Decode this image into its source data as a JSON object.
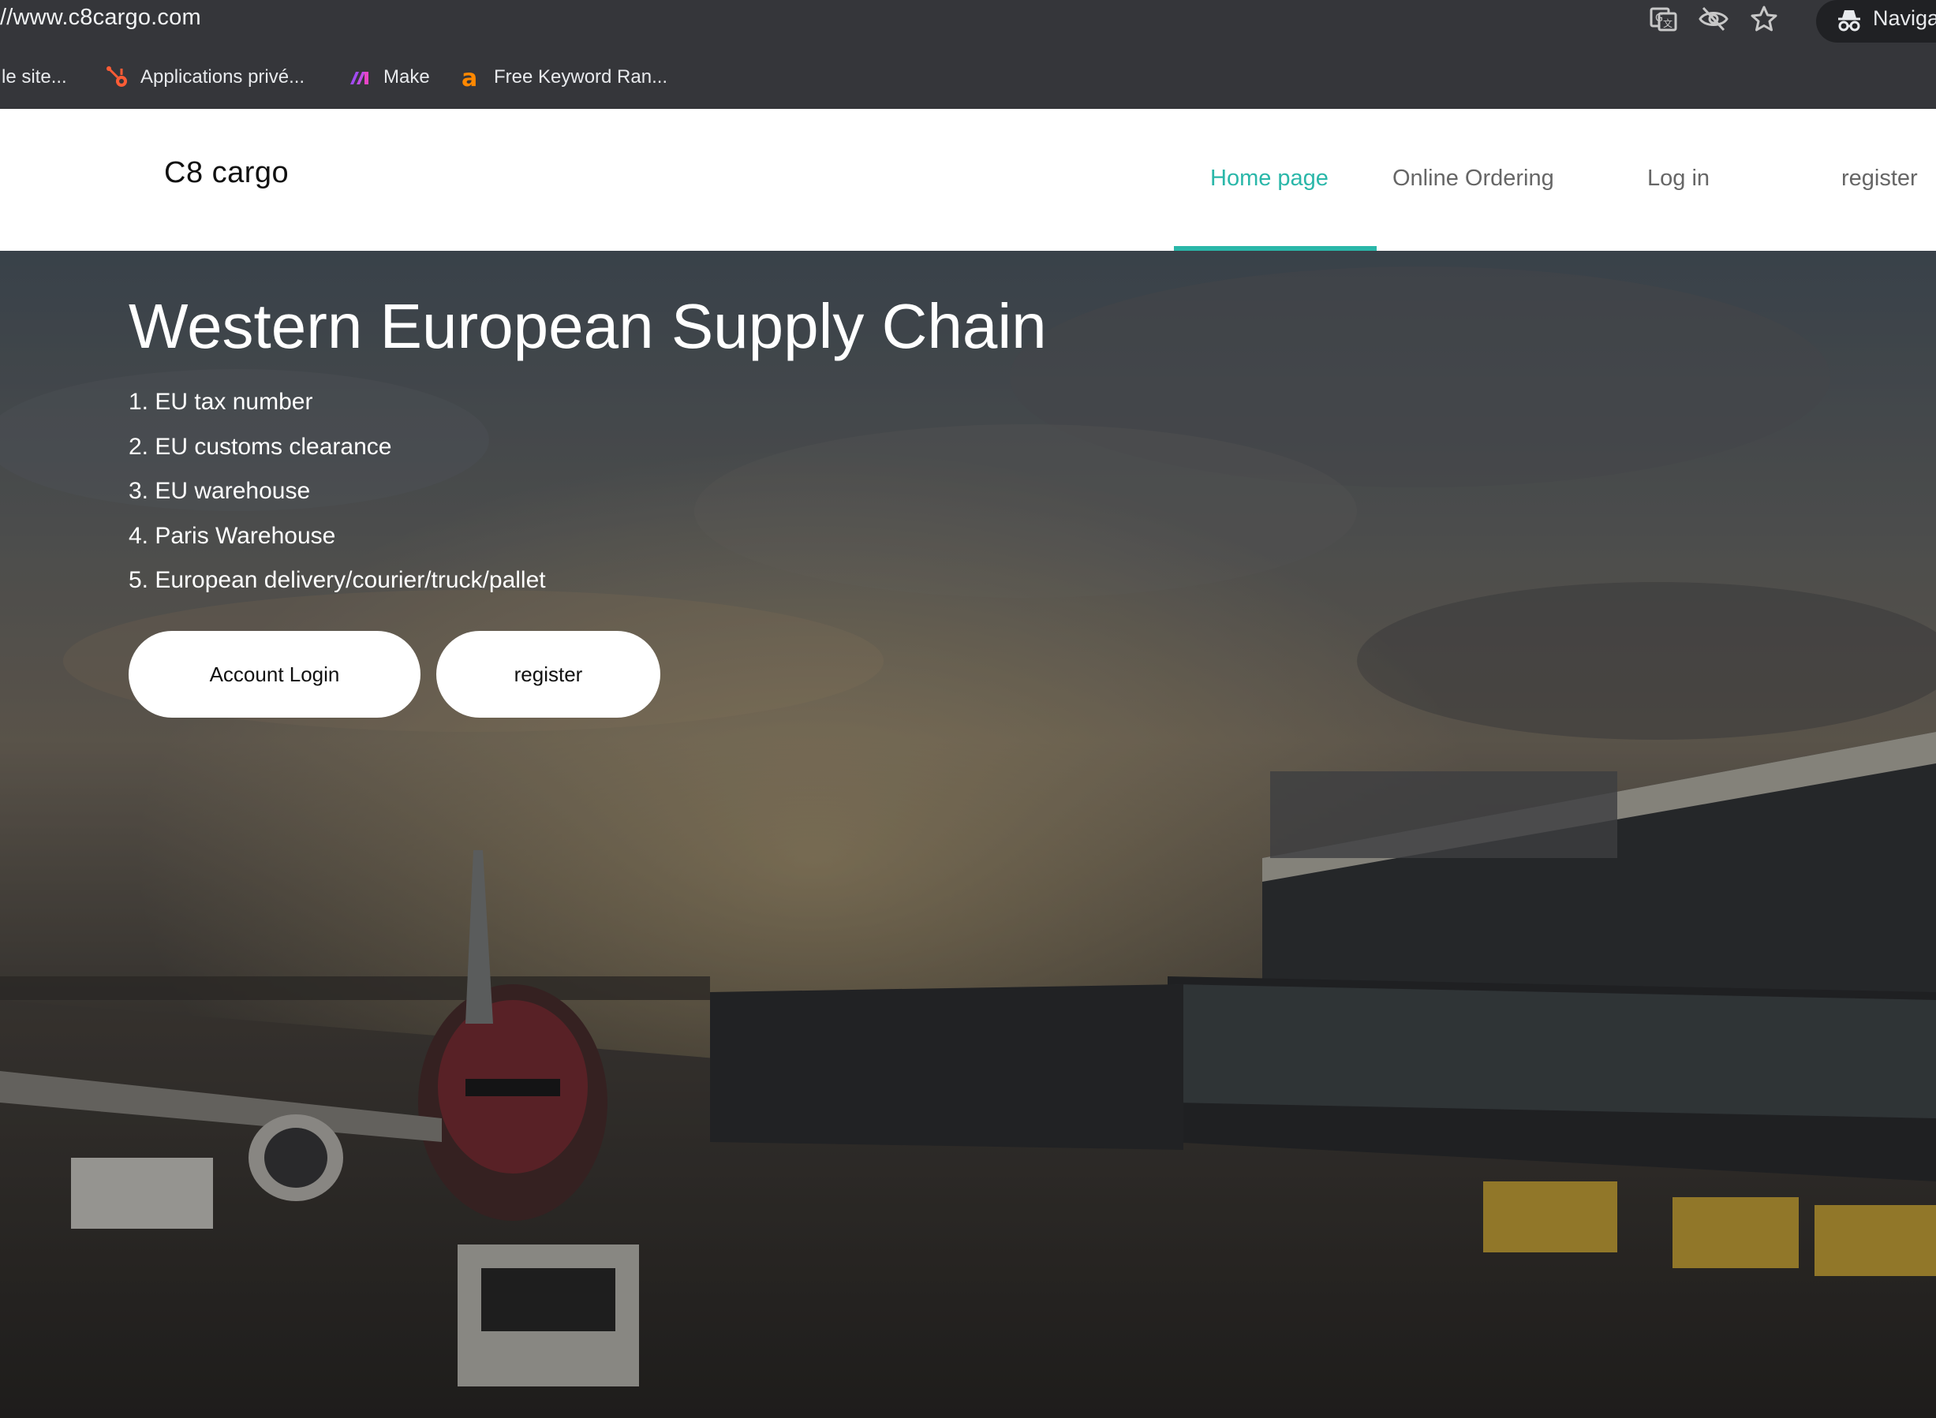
{
  "browser": {
    "url": "//www.c8cargo.com",
    "profile_label": "Naviga",
    "icons": [
      "translate-icon",
      "eye-slash-icon",
      "star-icon",
      "incognito-icon"
    ],
    "bookmarks": [
      {
        "label": "le site...",
        "icon": "none"
      },
      {
        "label": "Applications privé...",
        "icon": "hubspot-icon"
      },
      {
        "label": "Make",
        "icon": "make-icon"
      },
      {
        "label": "Free Keyword Ran...",
        "icon": "ahrefs-icon"
      }
    ]
  },
  "site": {
    "logo": "C8 cargo",
    "accent_color": "#2ab7a9",
    "nav": [
      {
        "label": "Home page",
        "active": true
      },
      {
        "label": "Online Ordering",
        "active": false
      },
      {
        "label": "Log in",
        "active": false
      },
      {
        "label": "register",
        "active": false
      }
    ]
  },
  "hero": {
    "title": "Western European Supply Chain",
    "items": [
      "1. EU tax number",
      "2. EU customs clearance",
      "3. EU warehouse",
      "4. Paris Warehouse",
      "5. European delivery/courier/truck/pallet"
    ],
    "buttons": {
      "login": "Account Login",
      "register": "register"
    }
  }
}
